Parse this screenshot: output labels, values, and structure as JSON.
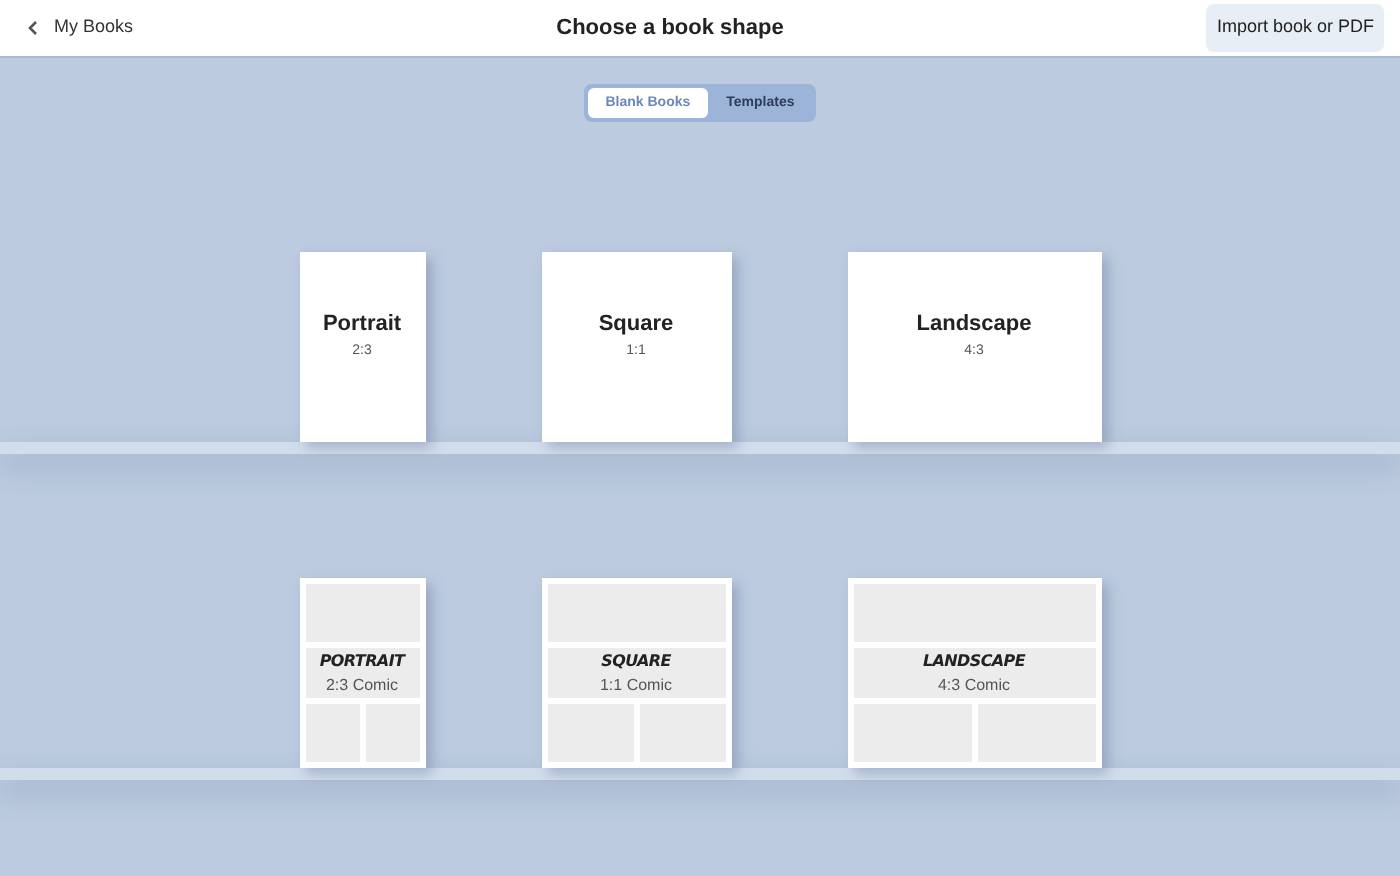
{
  "header": {
    "back_label": "My Books",
    "title": "Choose a book shape",
    "import_button": "Import book or PDF"
  },
  "segments": [
    {
      "label": "Blank Books",
      "selected": true
    },
    {
      "label": "Templates",
      "selected": false
    }
  ],
  "shelves": [
    {
      "kind": "blank",
      "books": [
        {
          "kind": "portrait",
          "title": "Portrait",
          "ratio": "2:3"
        },
        {
          "kind": "square",
          "title": "Square",
          "ratio": "1:1"
        },
        {
          "kind": "landscape",
          "title": "Landscape",
          "ratio": "4:3"
        }
      ]
    },
    {
      "kind": "comic",
      "books": [
        {
          "kind": "portrait",
          "title": "PORTRAIT",
          "ratio": "2:3 Comic"
        },
        {
          "kind": "square",
          "title": "SQUARE",
          "ratio": "1:1 Comic"
        },
        {
          "kind": "landscape",
          "title": "LANDSCAPE",
          "ratio": "4:3 Comic"
        }
      ]
    }
  ]
}
